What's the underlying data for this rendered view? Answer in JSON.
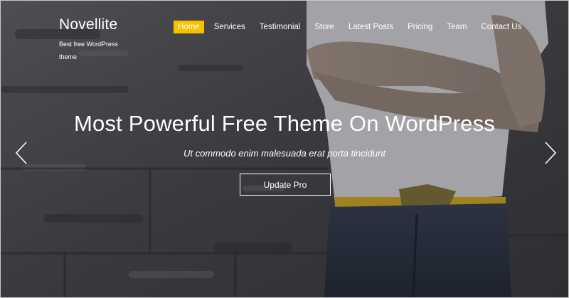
{
  "brand": {
    "name": "Novellite",
    "tagline": "Best free WordPress theme"
  },
  "nav": {
    "items": [
      {
        "label": "Home",
        "active": true
      },
      {
        "label": "Services"
      },
      {
        "label": "Testimonial"
      },
      {
        "label": "Store"
      },
      {
        "label": "Latest Posts"
      },
      {
        "label": "Pricing"
      },
      {
        "label": "Team"
      },
      {
        "label": "Contact Us"
      }
    ]
  },
  "hero": {
    "title": "Most Powerful Free Theme On WordPress",
    "subtitle": "Ut commodo enim malesuada erat porta tincidunt",
    "button_label": "Update Pro",
    "prev_icon": "chevron-left-icon",
    "next_icon": "chevron-right-icon"
  },
  "colors": {
    "accent": "#f7c300",
    "text": "#ffffff",
    "wall": "#5a5a5e"
  }
}
